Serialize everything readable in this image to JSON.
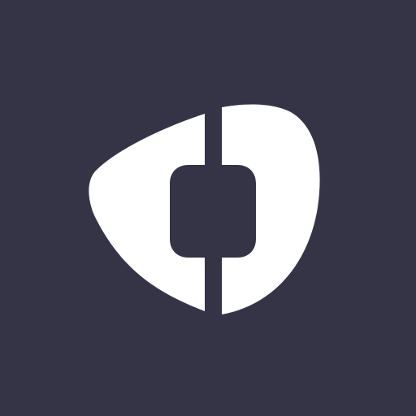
{
  "app_icon": {
    "icon": "guitar-pick-logo-icon",
    "colors": {
      "background": "#353447",
      "mark": "#ffffff"
    }
  }
}
